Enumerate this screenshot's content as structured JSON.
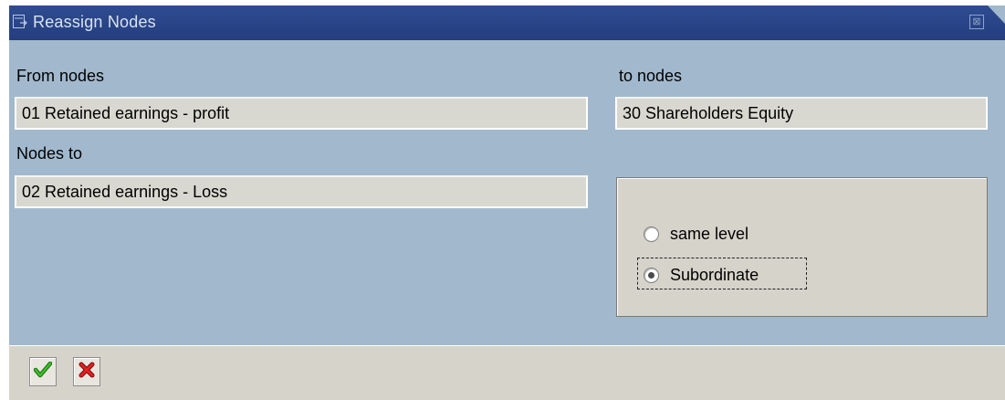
{
  "dialog": {
    "title": "Reassign Nodes",
    "close_glyph": "⊠",
    "title_icon": "window-icon"
  },
  "form": {
    "from_nodes_label": "From nodes",
    "from_nodes_value": "01 Retained earnings - profit",
    "to_nodes_label": "to nodes",
    "to_nodes_value": "30 Shareholders Equity",
    "nodes_to_label": "Nodes to",
    "nodes_to_value": "02 Retained earnings - Loss"
  },
  "placement": {
    "options": [
      {
        "label": "same level",
        "selected": false
      },
      {
        "label": "Subordinate",
        "selected": true
      }
    ]
  },
  "toolbar": {
    "confirm_icon": "checkmark-icon",
    "cancel_icon": "cancel-icon",
    "confirm_color": "#2f9a1f",
    "cancel_color": "#d01818"
  },
  "colors": {
    "dialog_background": "#a2b9cd",
    "titlebar": "#2f4c91",
    "field_background": "#d8d8d0"
  }
}
